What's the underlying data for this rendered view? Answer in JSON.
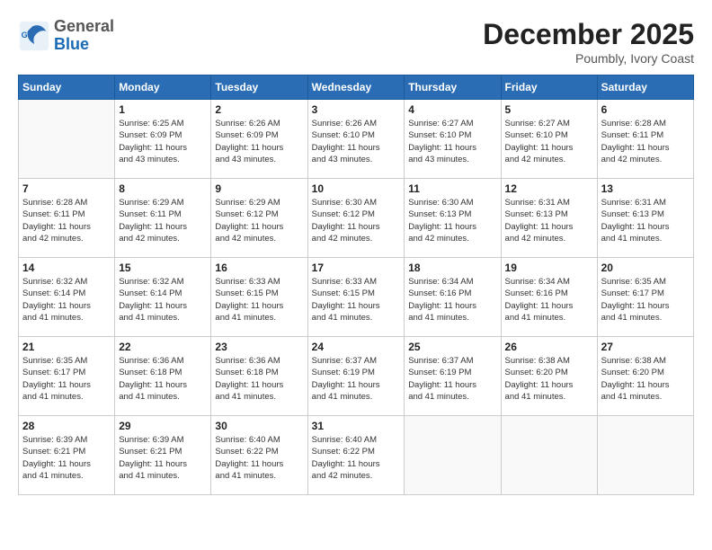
{
  "header": {
    "logo": {
      "general": "General",
      "blue": "Blue"
    },
    "title": "December 2025",
    "subtitle": "Poumbly, Ivory Coast"
  },
  "calendar": {
    "weekdays": [
      "Sunday",
      "Monday",
      "Tuesday",
      "Wednesday",
      "Thursday",
      "Friday",
      "Saturday"
    ],
    "weeks": [
      [
        {
          "day": "",
          "info": ""
        },
        {
          "day": "1",
          "info": "Sunrise: 6:25 AM\nSunset: 6:09 PM\nDaylight: 11 hours\nand 43 minutes."
        },
        {
          "day": "2",
          "info": "Sunrise: 6:26 AM\nSunset: 6:09 PM\nDaylight: 11 hours\nand 43 minutes."
        },
        {
          "day": "3",
          "info": "Sunrise: 6:26 AM\nSunset: 6:10 PM\nDaylight: 11 hours\nand 43 minutes."
        },
        {
          "day": "4",
          "info": "Sunrise: 6:27 AM\nSunset: 6:10 PM\nDaylight: 11 hours\nand 43 minutes."
        },
        {
          "day": "5",
          "info": "Sunrise: 6:27 AM\nSunset: 6:10 PM\nDaylight: 11 hours\nand 42 minutes."
        },
        {
          "day": "6",
          "info": "Sunrise: 6:28 AM\nSunset: 6:11 PM\nDaylight: 11 hours\nand 42 minutes."
        }
      ],
      [
        {
          "day": "7",
          "info": "Sunrise: 6:28 AM\nSunset: 6:11 PM\nDaylight: 11 hours\nand 42 minutes."
        },
        {
          "day": "8",
          "info": "Sunrise: 6:29 AM\nSunset: 6:11 PM\nDaylight: 11 hours\nand 42 minutes."
        },
        {
          "day": "9",
          "info": "Sunrise: 6:29 AM\nSunset: 6:12 PM\nDaylight: 11 hours\nand 42 minutes."
        },
        {
          "day": "10",
          "info": "Sunrise: 6:30 AM\nSunset: 6:12 PM\nDaylight: 11 hours\nand 42 minutes."
        },
        {
          "day": "11",
          "info": "Sunrise: 6:30 AM\nSunset: 6:13 PM\nDaylight: 11 hours\nand 42 minutes."
        },
        {
          "day": "12",
          "info": "Sunrise: 6:31 AM\nSunset: 6:13 PM\nDaylight: 11 hours\nand 42 minutes."
        },
        {
          "day": "13",
          "info": "Sunrise: 6:31 AM\nSunset: 6:13 PM\nDaylight: 11 hours\nand 41 minutes."
        }
      ],
      [
        {
          "day": "14",
          "info": "Sunrise: 6:32 AM\nSunset: 6:14 PM\nDaylight: 11 hours\nand 41 minutes."
        },
        {
          "day": "15",
          "info": "Sunrise: 6:32 AM\nSunset: 6:14 PM\nDaylight: 11 hours\nand 41 minutes."
        },
        {
          "day": "16",
          "info": "Sunrise: 6:33 AM\nSunset: 6:15 PM\nDaylight: 11 hours\nand 41 minutes."
        },
        {
          "day": "17",
          "info": "Sunrise: 6:33 AM\nSunset: 6:15 PM\nDaylight: 11 hours\nand 41 minutes."
        },
        {
          "day": "18",
          "info": "Sunrise: 6:34 AM\nSunset: 6:16 PM\nDaylight: 11 hours\nand 41 minutes."
        },
        {
          "day": "19",
          "info": "Sunrise: 6:34 AM\nSunset: 6:16 PM\nDaylight: 11 hours\nand 41 minutes."
        },
        {
          "day": "20",
          "info": "Sunrise: 6:35 AM\nSunset: 6:17 PM\nDaylight: 11 hours\nand 41 minutes."
        }
      ],
      [
        {
          "day": "21",
          "info": "Sunrise: 6:35 AM\nSunset: 6:17 PM\nDaylight: 11 hours\nand 41 minutes."
        },
        {
          "day": "22",
          "info": "Sunrise: 6:36 AM\nSunset: 6:18 PM\nDaylight: 11 hours\nand 41 minutes."
        },
        {
          "day": "23",
          "info": "Sunrise: 6:36 AM\nSunset: 6:18 PM\nDaylight: 11 hours\nand 41 minutes."
        },
        {
          "day": "24",
          "info": "Sunrise: 6:37 AM\nSunset: 6:19 PM\nDaylight: 11 hours\nand 41 minutes."
        },
        {
          "day": "25",
          "info": "Sunrise: 6:37 AM\nSunset: 6:19 PM\nDaylight: 11 hours\nand 41 minutes."
        },
        {
          "day": "26",
          "info": "Sunrise: 6:38 AM\nSunset: 6:20 PM\nDaylight: 11 hours\nand 41 minutes."
        },
        {
          "day": "27",
          "info": "Sunrise: 6:38 AM\nSunset: 6:20 PM\nDaylight: 11 hours\nand 41 minutes."
        }
      ],
      [
        {
          "day": "28",
          "info": "Sunrise: 6:39 AM\nSunset: 6:21 PM\nDaylight: 11 hours\nand 41 minutes."
        },
        {
          "day": "29",
          "info": "Sunrise: 6:39 AM\nSunset: 6:21 PM\nDaylight: 11 hours\nand 41 minutes."
        },
        {
          "day": "30",
          "info": "Sunrise: 6:40 AM\nSunset: 6:22 PM\nDaylight: 11 hours\nand 41 minutes."
        },
        {
          "day": "31",
          "info": "Sunrise: 6:40 AM\nSunset: 6:22 PM\nDaylight: 11 hours\nand 42 minutes."
        },
        {
          "day": "",
          "info": ""
        },
        {
          "day": "",
          "info": ""
        },
        {
          "day": "",
          "info": ""
        }
      ]
    ]
  }
}
